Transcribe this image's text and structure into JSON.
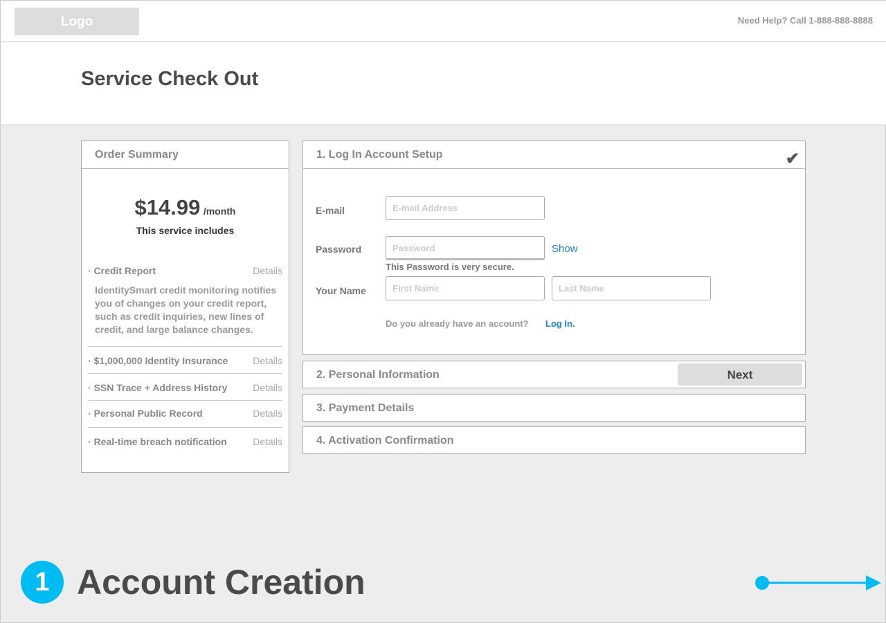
{
  "header": {
    "logo": "Logo",
    "help": "Need Help? Call 1-888-888-8888"
  },
  "page_title": "Service Check Out",
  "summary": {
    "title": "Order Summary",
    "price": "$14.99",
    "period": "/month",
    "includes": "This service includes",
    "items": [
      {
        "label": "Credit Report",
        "details": "Details"
      },
      {
        "label": "$1,000,000 Identity Insurance",
        "details": "Details"
      },
      {
        "label": "SSN Trace + Address History",
        "details": "Details"
      },
      {
        "label": "Personal Public Record",
        "details": "Details"
      },
      {
        "label": "Real-time breach notification",
        "details": "Details"
      }
    ],
    "credit_desc": "IdentitySmart credit monitoring notifies you of changes on your credit report, such as credit inquiries, new lines of credit, and large balance changes."
  },
  "step1": {
    "title": "1. Log In Account Setup",
    "check": "✔",
    "email_label": "E-mail",
    "email_placeholder": "E-mail Address",
    "password_label": "Password",
    "password_placeholder": "Password",
    "show": "Show",
    "strength": "This Password is very secure.",
    "name_label": "Your Name",
    "first_placeholder": "First Name",
    "last_placeholder": "Last Name",
    "account_q": "Do you already have an account?",
    "login": "Log In."
  },
  "steps": [
    {
      "title": "2. Personal Information",
      "button": "Next"
    },
    {
      "title": "3. Payment Details"
    },
    {
      "title": "4. Activation Confirmation"
    }
  ],
  "footer": {
    "number": "1",
    "title": "Account Creation"
  },
  "colors": {
    "accent": "#00bcf2",
    "link": "#1a7fe6"
  }
}
